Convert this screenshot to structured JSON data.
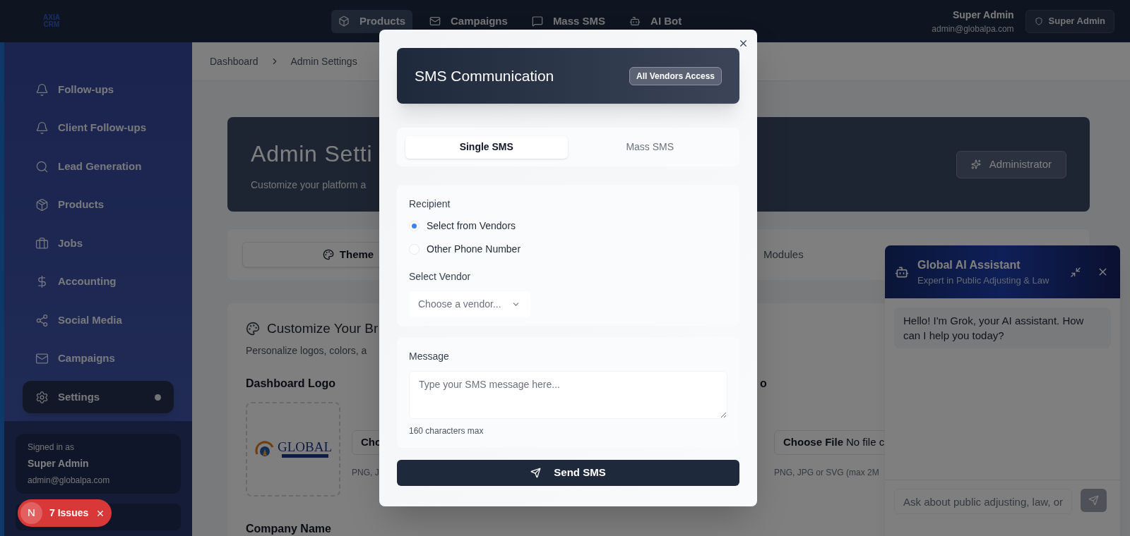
{
  "topbar": {
    "logo": [
      "AXIA",
      "CRM"
    ],
    "nav": [
      {
        "label": "Products",
        "selected": true
      },
      {
        "label": "Campaigns",
        "selected": false
      },
      {
        "label": "Mass SMS",
        "selected": false
      },
      {
        "label": "AI Bot",
        "selected": false
      }
    ],
    "user": {
      "name": "Super Admin",
      "email": "admin@globalpa.com"
    },
    "role_badge": "Super Admin"
  },
  "sidebar": {
    "items": [
      {
        "label": "Follow-ups",
        "selected": false
      },
      {
        "label": "Client Follow-ups",
        "selected": false
      },
      {
        "label": "Lead Generation",
        "selected": false
      },
      {
        "label": "Products",
        "selected": false
      },
      {
        "label": "Jobs",
        "selected": false
      },
      {
        "label": "Accounting",
        "selected": false
      },
      {
        "label": "Social Media",
        "selected": false
      },
      {
        "label": "Campaigns",
        "selected": false
      },
      {
        "label": "Settings",
        "selected": true
      }
    ],
    "signed_in": {
      "caption": "Signed in as",
      "name": "Super Admin",
      "email": "admin@globalpa.com"
    }
  },
  "issues_badge": {
    "avatar": "N",
    "label": "7 Issues"
  },
  "breadcrumb": [
    "Dashboard",
    "Admin Settings"
  ],
  "hero": {
    "title": "Admin Setti",
    "subtitle": "Customize your platform a",
    "button": "Administrator"
  },
  "settings_tabs": [
    {
      "label": "Theme",
      "selected": true
    },
    {
      "label": "Modules",
      "selected": false
    }
  ],
  "branding": {
    "title": "Customize Your Br",
    "subtitle": "Personalize logos, colors, a",
    "dashboard_logo": {
      "label": "Dashboard Logo",
      "logo_text": "GLOBAL",
      "file_button": "Cho",
      "hint": "PNG, J"
    },
    "second_logo": {
      "label": "o",
      "file_button": "Choose File",
      "file_status": "No file c",
      "hint": "PNG, JPG or SVG (max 2M"
    },
    "next_label": "Company Name"
  },
  "modal": {
    "title": "SMS Communication",
    "badge": "All Vendors Access",
    "tabs": [
      {
        "label": "Single SMS",
        "selected": true
      },
      {
        "label": "Mass SMS",
        "selected": false
      }
    ],
    "recipient_label": "Recipient",
    "recipient_options": [
      {
        "label": "Select from Vendors",
        "selected": true
      },
      {
        "label": "Other Phone Number",
        "selected": false
      }
    ],
    "vendor_label": "Select Vendor",
    "vendor_placeholder": "Choose a vendor...",
    "message_label": "Message",
    "message_placeholder": "Type your SMS message here...",
    "message_hint": "160 characters max",
    "send_button": "Send SMS"
  },
  "chat": {
    "title": "Global AI Assistant",
    "subtitle": "Expert in Public Adjusting & Law",
    "messages": [
      {
        "text": "Hello! I'm Grok, your AI assistant. How can I help you today?"
      }
    ],
    "input_placeholder": "Ask about public adjusting, law, or"
  }
}
